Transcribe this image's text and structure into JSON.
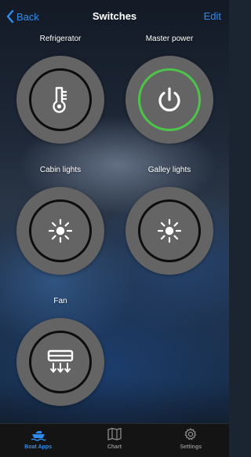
{
  "nav": {
    "back_label": "Back",
    "title": "Switches",
    "edit_label": "Edit"
  },
  "switches": [
    {
      "label": "Refrigerator",
      "icon": "thermometer-icon",
      "state": "off"
    },
    {
      "label": "Master power",
      "icon": "power-icon",
      "state": "on"
    },
    {
      "label": "Cabin lights",
      "icon": "light-icon",
      "state": "off"
    },
    {
      "label": "Galley lights",
      "icon": "light-icon",
      "state": "off"
    },
    {
      "label": "Fan",
      "icon": "fan-icon",
      "state": "off"
    }
  ],
  "tabbar": {
    "items": [
      {
        "label": "Boat Apps",
        "icon": "boat-icon",
        "active": true
      },
      {
        "label": "Chart",
        "icon": "chart-icon",
        "active": false
      },
      {
        "label": "Settings",
        "icon": "gear-icon",
        "active": false
      }
    ]
  },
  "colors": {
    "accent": "#2f8df2",
    "switch_on_ring": "#4cc54a",
    "switch_off_ring": "#0d0d0d",
    "switch_body": "#646464",
    "tabbar_bg": "#141414"
  }
}
